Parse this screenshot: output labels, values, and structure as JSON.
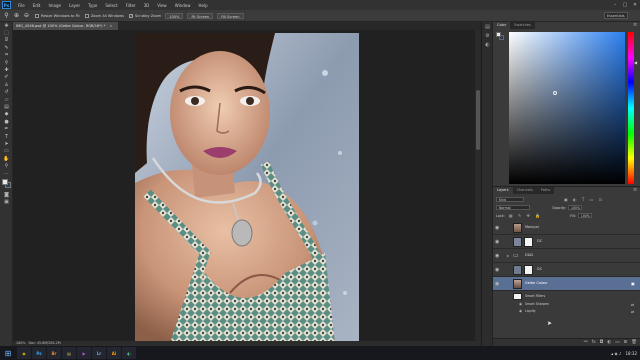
{
  "app": {
    "logo_text": "Ps"
  },
  "menu": [
    "File",
    "Edit",
    "Image",
    "Layer",
    "Type",
    "Select",
    "Filter",
    "3D",
    "View",
    "Window",
    "Help"
  ],
  "window_controls": [
    "–",
    "▢",
    "✕"
  ],
  "options_bar": {
    "checkboxes": [
      {
        "label": "Resize Windows to Fit",
        "checked": false
      },
      {
        "label": "Zoom All Windows",
        "checked": false
      },
      {
        "label": "Scrubby Zoom",
        "checked": true
      }
    ],
    "buttons": [
      "100%",
      "Fit Screen",
      "Fill Screen"
    ],
    "workspace": "Essentials"
  },
  "document": {
    "tab_title": "IMG_4546.psd @ 100% (Gelbe Colour, RGB/16*) *",
    "status_zoom": "100%",
    "status_doc": "Doc: 45.8M/284.2M"
  },
  "color_panel": {
    "tabs": [
      "Color",
      "Swatches"
    ],
    "active_tab": 0,
    "marker_color": "#7d8ba8"
  },
  "layers_panel": {
    "tabs": [
      "Layers",
      "Channels",
      "Paths"
    ],
    "active_tab": 0,
    "filter_kind": "Kind",
    "blend_mode": "Normal",
    "opacity_label": "Opacity:",
    "opacity_value": "100%",
    "lock_label": "Lock:",
    "fill_label": "Fill:",
    "fill_value": "100%",
    "layers": [
      {
        "name": "Manipal",
        "visible": true,
        "selected": false,
        "thumb": "photo"
      },
      {
        "name": "DC",
        "visible": true,
        "selected": false,
        "thumb": "mask"
      },
      {
        "name": "D&D",
        "visible": true,
        "selected": false,
        "thumb": "folder"
      },
      {
        "name": "DC",
        "visible": true,
        "selected": false,
        "thumb": "mask"
      },
      {
        "name": "Gelbe Colour",
        "visible": true,
        "selected": true,
        "thumb": "photo"
      }
    ],
    "smart_filters": {
      "label": "Smart Filters",
      "items": [
        "Smart Sharpen",
        "Liquify"
      ]
    }
  },
  "taskbar": {
    "apps": [
      {
        "icon": "chrome-icon",
        "label": "◉",
        "color": "#e8b300"
      },
      {
        "icon": "ps-icon",
        "label": "Ps",
        "color": "#31a8ff"
      },
      {
        "icon": "br-icon",
        "label": "Br",
        "color": "#e08a2b"
      },
      {
        "icon": "folder-icon",
        "label": "▤",
        "color": "#e7c24a"
      },
      {
        "icon": "media-icon",
        "label": "▶",
        "color": "#c34fe0"
      },
      {
        "icon": "lr-icon",
        "label": "Lr",
        "color": "#70a8de"
      },
      {
        "icon": "ai-icon",
        "label": "Ai",
        "color": "#ff9a00"
      },
      {
        "icon": "app-icon",
        "label": "◐",
        "color": "#5ad08a"
      }
    ],
    "time": "18:32"
  }
}
